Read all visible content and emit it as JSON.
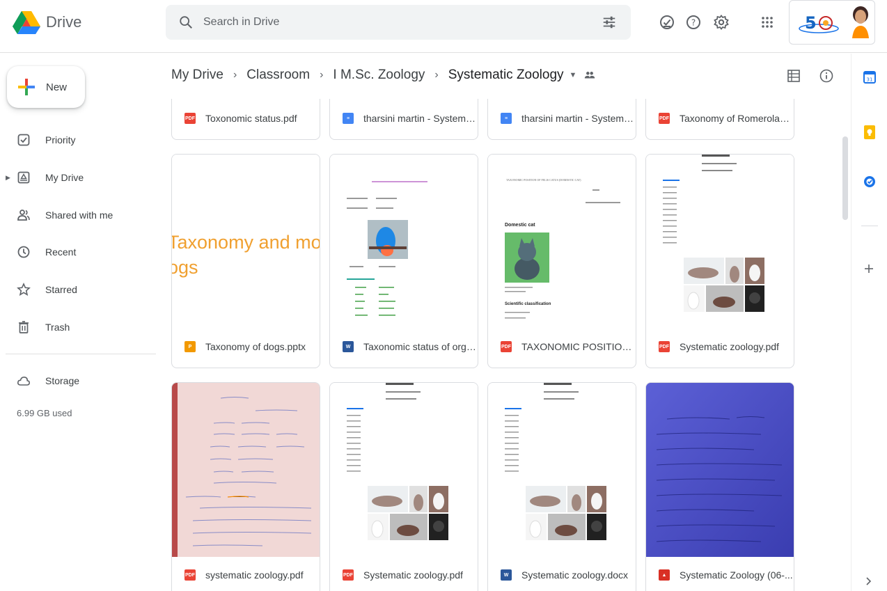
{
  "app": {
    "title": "Drive"
  },
  "search": {
    "placeholder": "Search in Drive"
  },
  "header_icons": [
    "offline-status-icon",
    "help-icon",
    "settings-icon",
    "apps-grid-icon"
  ],
  "sidebar": {
    "new_label": "New",
    "items": [
      {
        "label": "Priority",
        "icon": "priority-icon"
      },
      {
        "label": "My Drive",
        "icon": "my-drive-icon"
      },
      {
        "label": "Shared with me",
        "icon": "shared-icon"
      },
      {
        "label": "Recent",
        "icon": "clock-icon"
      },
      {
        "label": "Starred",
        "icon": "star-icon"
      },
      {
        "label": "Trash",
        "icon": "trash-icon"
      }
    ],
    "storage_label": "Storage",
    "storage_used": "6.99 GB used"
  },
  "breadcrumb": {
    "items": [
      "My Drive",
      "Classroom",
      "I M.Sc. Zoology",
      "Systematic Zoology"
    ]
  },
  "files": [
    {
      "name": "Toxonomic status.pdf",
      "type": "pdf",
      "icon_text": "PDF"
    },
    {
      "name": "tharsini martin - Systema...",
      "type": "doc",
      "icon_text": "≡"
    },
    {
      "name": "tharsini martin - Systema...",
      "type": "doc",
      "icon_text": "≡"
    },
    {
      "name": "Taxonomy of Romerolaga...",
      "type": "pdf",
      "icon_text": "PDF"
    },
    {
      "name": "Taxonomy of dogs.pptx",
      "type": "ppt",
      "icon_text": "P",
      "preview_line1": "Taxonomy and morph",
      "preview_line2": "ogs"
    },
    {
      "name": "Taxonomic status of orga...",
      "type": "word",
      "icon_text": "W"
    },
    {
      "name": "TAXONOMIC POSITION O...",
      "type": "pdf",
      "icon_text": "PDF",
      "preview_heading": "TAXONOMIC POSITION OF FELIS CATUS (DOMESTIC CAT)",
      "preview_sub1": "Domestic cat",
      "preview_sub2": "Scientific classification"
    },
    {
      "name": "Systematic zoology.pdf",
      "type": "pdf",
      "icon_text": "PDF"
    },
    {
      "name": "systematic zoology.pdf",
      "type": "pdf",
      "icon_text": "PDF"
    },
    {
      "name": "Systematic zoology.pdf",
      "type": "pdf",
      "icon_text": "PDF"
    },
    {
      "name": "Systematic zoology.docx",
      "type": "word",
      "icon_text": "W"
    },
    {
      "name": "Systematic Zoology (06-...",
      "type": "img",
      "icon_text": "▲"
    }
  ],
  "colors": {
    "accent": "#1a73e8",
    "pdf": "#ea4335",
    "doc": "#4285f4",
    "ppt": "#f29900",
    "word": "#2b579a"
  }
}
